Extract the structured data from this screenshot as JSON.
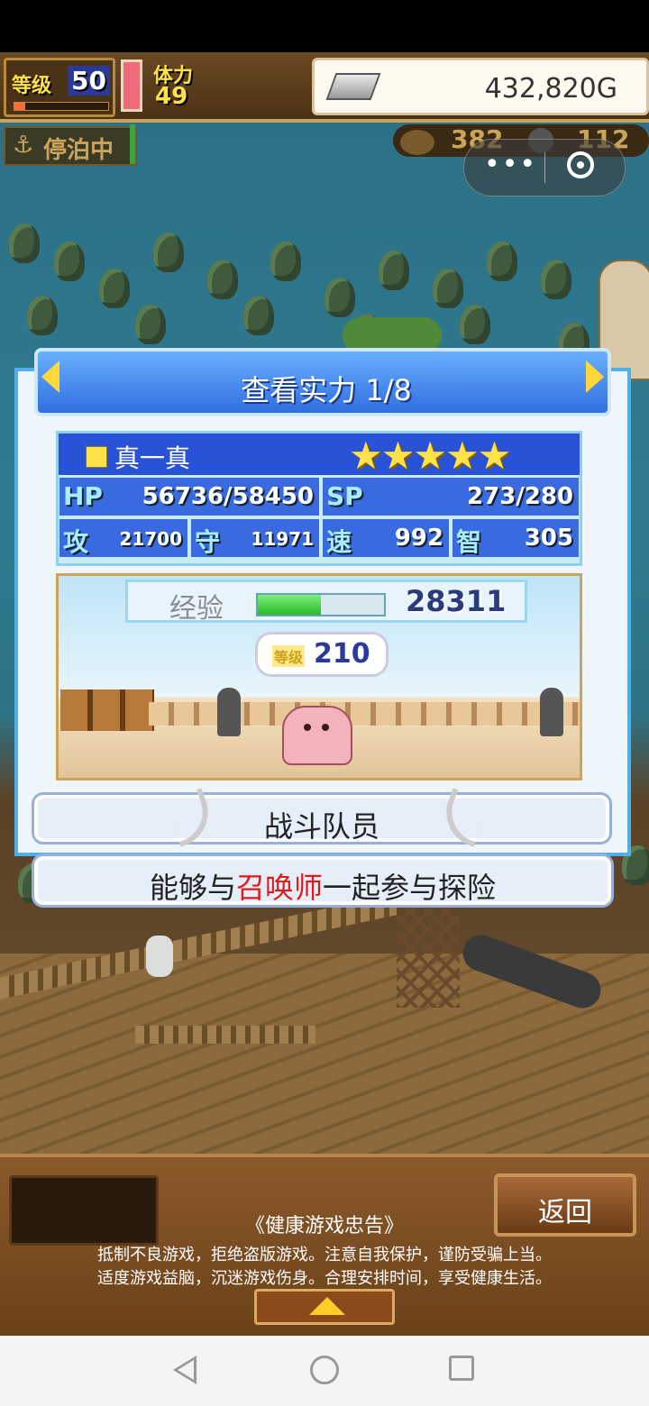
{
  "hud": {
    "level_label": "等级",
    "level_value": "50",
    "level_progress": 0.12,
    "stamina_label": "体力",
    "stamina_value": "49",
    "gold": "432,820G"
  },
  "status": {
    "anchor_text": "停泊中",
    "resource1": "382",
    "resource2": "112"
  },
  "miniprogram": {
    "more": "•••"
  },
  "dialog": {
    "title": "查看实力 1/8",
    "character": {
      "name": "真一真",
      "stars": "★★★★★",
      "star_count": 5,
      "hp_label": "HP",
      "hp_value": "56736/58450",
      "sp_label": "SP",
      "sp_value": "273/280",
      "atk_label": "攻",
      "atk_value": "21700",
      "def_label": "守",
      "def_value": "11971",
      "spd_label": "速",
      "spd_value": "992",
      "int_label": "智",
      "int_value": "305"
    },
    "exp_label": "经验",
    "exp_value": "28311",
    "exp_progress": 0.5,
    "level_label": "等级",
    "level_value": "210",
    "role": "战斗队员",
    "description_prefix": "能够与",
    "description_highlight": "召唤师",
    "description_suffix": "一起参与探险"
  },
  "bottom": {
    "back_label": "返回",
    "advice_title": "《健康游戏忠告》",
    "advice_line1": "抵制不良游戏，拒绝盗版游戏。注意自我保护，谨防受骗上当。",
    "advice_line2": "适度游戏益脑，沉迷游戏伤身。合理安排时间，享受健康生活。"
  },
  "colors": {
    "accent_blue": "#2a52d6",
    "highlight_red": "#e01a1a",
    "exp_green": "#2ab82a"
  }
}
